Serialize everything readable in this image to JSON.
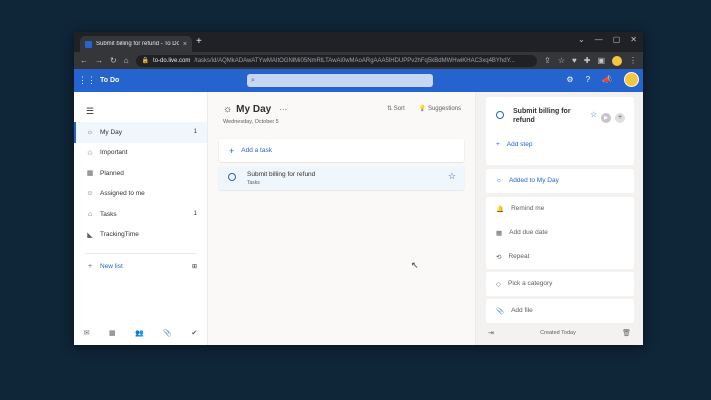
{
  "browser": {
    "tab_title": "Submit billing for refund - To Do",
    "tab_close": "×",
    "new_tab": "+",
    "url_host": "to-do.live.com",
    "url_path": "/tasks/id/AQMkADAwATYwMAItOGNlMi05NmRlLTAwAi0wMAoARgAAA5lHDUPPv2hFq5kBdMWHwiKHAC3xq4BYhdY..."
  },
  "app": {
    "name": "To Do",
    "header_icons": [
      "settings-icon",
      "help-icon",
      "megaphone-icon",
      "avatar"
    ]
  },
  "sidebar": {
    "items": [
      {
        "label": "My Day",
        "count": "1",
        "icon": "sun-icon"
      },
      {
        "label": "Important",
        "count": "",
        "icon": "star-icon"
      },
      {
        "label": "Planned",
        "count": "",
        "icon": "calendar-icon"
      },
      {
        "label": "Assigned to me",
        "count": "",
        "icon": "person-icon"
      },
      {
        "label": "Tasks",
        "count": "1",
        "icon": "home-icon"
      },
      {
        "label": "TrackingTime",
        "count": "",
        "icon": "app-icon"
      }
    ],
    "new_list": "New list"
  },
  "main": {
    "title": "My Day",
    "date": "Wednesday, October 5",
    "sort": "Sort",
    "suggestions": "Suggestions",
    "add_task": "Add a task",
    "task": {
      "name": "Submit billing for refund",
      "list": "Tasks"
    }
  },
  "detail": {
    "title": "Submit billing for refund",
    "add_step": "Add step",
    "added_to_my_day": "Added to My Day",
    "remind_me": "Remind me",
    "add_due_date": "Add due date",
    "repeat": "Repeat",
    "pick_category": "Pick a category",
    "add_file": "Add file",
    "created": "Created Today"
  },
  "colors": {
    "accent": "#2564cf",
    "active_bg": "#eff6fc"
  }
}
